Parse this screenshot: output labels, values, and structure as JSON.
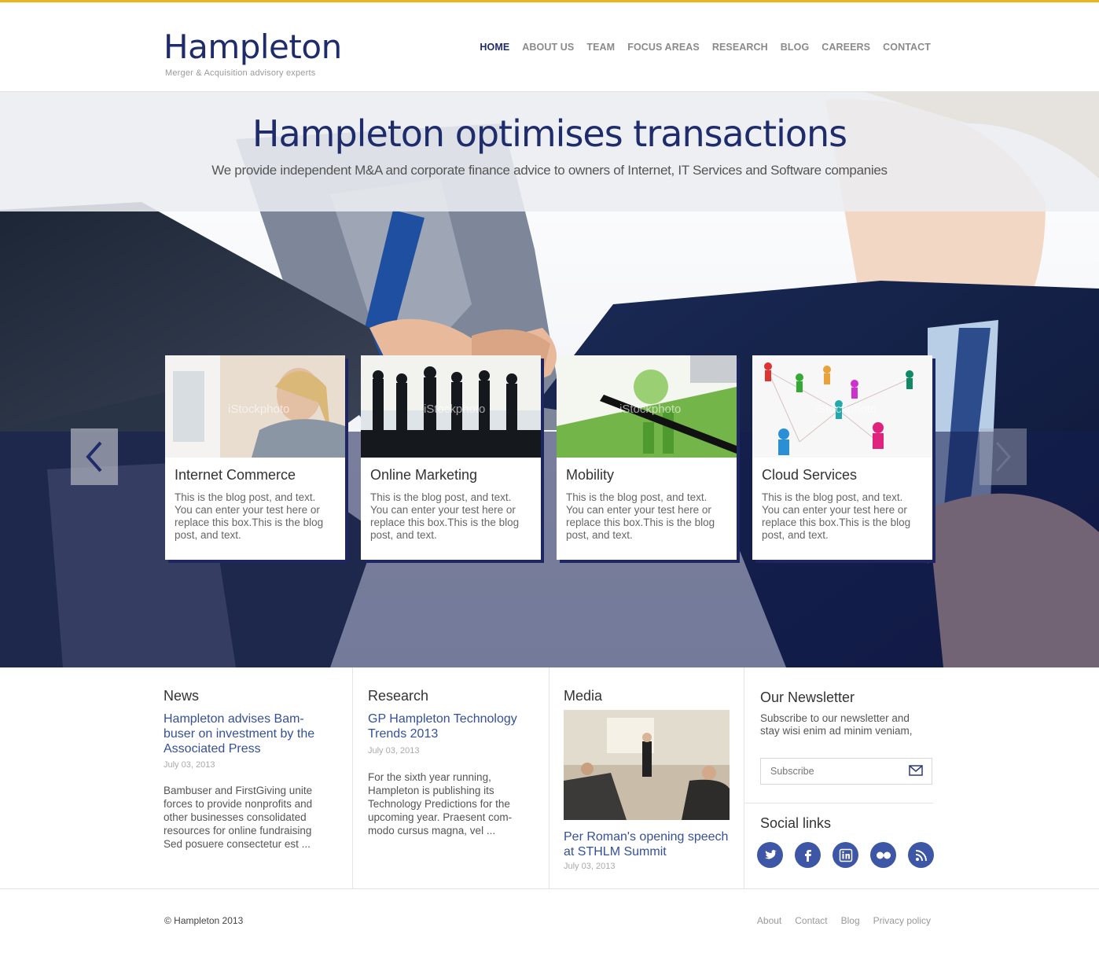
{
  "brand": {
    "name": "Hampleton",
    "tagline": "Merger & Acquisition advisory experts",
    "accent": "#1f2c6b",
    "topbar_color": "#e8b51c"
  },
  "nav": {
    "items": [
      "HOME",
      "ABOUT US",
      "TEAM",
      "FOCUS AREAS",
      "RESEARCH",
      "BLOG",
      "CAREERS",
      "CONTACT"
    ],
    "active": "HOME"
  },
  "hero": {
    "title": "Hampleton optimises transactions",
    "subtitle": "We provide independent M&A and corporate finance advice to owners of Internet, IT Services and Software companies"
  },
  "slider": {
    "prev_icon": "chevron-left-icon",
    "next_icon": "chevron-right-icon",
    "cards": [
      {
        "title": "Internet Commerce",
        "text": "This is the blog post, and text. You can enter your test here or replace this box.This is the blog post, and text.",
        "watermark": "iStockphoto"
      },
      {
        "title": "Online Marketing",
        "text": "This is the blog post, and text. You can enter your test here or replace this box.This is the blog post, and text.",
        "watermark": "iStockphoto"
      },
      {
        "title": "Mobility",
        "text": "This is the blog post, and text. You can enter your test here or replace this box.This is the blog post, and text.",
        "watermark": "iStockphoto"
      },
      {
        "title": "Cloud Services",
        "text": "This is the blog post, and text. You can enter your test here or replace this box.This is the blog post, and text.",
        "watermark": "iStockphoto"
      }
    ]
  },
  "news": {
    "title": "News",
    "link": "Hampleton advises Bam- buser on investment by the Associated Press",
    "date": "July 03, 2013",
    "text": "Bambuser and FirstGiving unite forces to provide nonprofits and other businesses consolidated resources for online fundraising Sed posuere consectetur est ..."
  },
  "research": {
    "title": "Research",
    "link": "GP Hampleton Technology Trends 2013",
    "date": "July 03, 2013",
    "text": "For the sixth year running, Hampleton is publishing its Technology Predictions for the upcoming year. Praesent com- modo cursus magna, vel ..."
  },
  "media": {
    "title": "Media",
    "link": "Per Roman's opening speech at STHLM Summit",
    "date": "July 03, 2013"
  },
  "newsletter": {
    "title": "Our Newsletter",
    "text": "Subscribe to our newsletter and stay wisi enim ad minim veniam,",
    "placeholder": "Subscribe",
    "icon": "envelope-icon"
  },
  "social": {
    "title": "Social links",
    "icons": [
      "twitter-icon",
      "facebook-icon",
      "linkedin-icon",
      "flickr-icon",
      "rss-icon"
    ]
  },
  "footer": {
    "copyright": "© Hampleton 2013",
    "links": [
      "About",
      "Contact",
      "Blog",
      "Privacy policy"
    ]
  }
}
